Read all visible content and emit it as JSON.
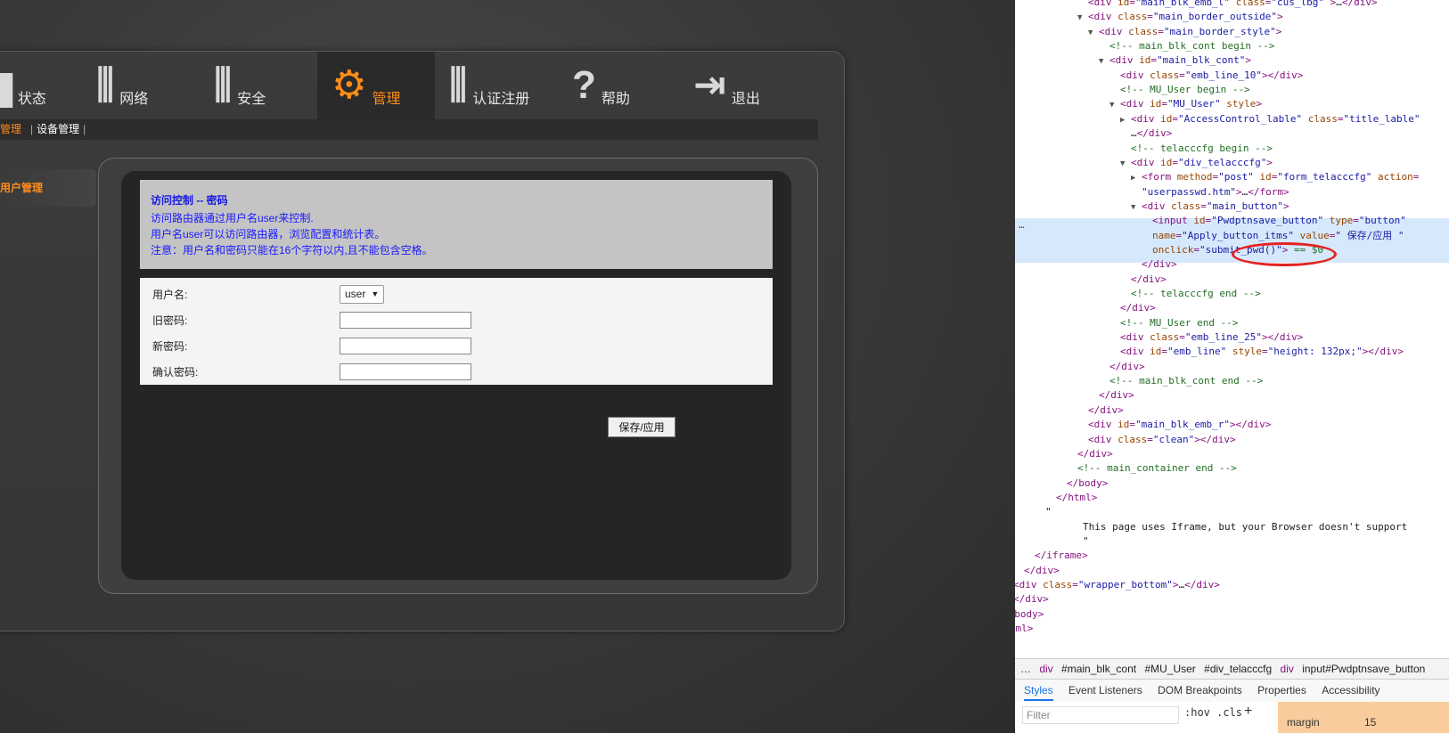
{
  "router": {
    "nav": [
      {
        "label": "状态",
        "icon": "status-icon",
        "glyph": "▆"
      },
      {
        "label": "网络",
        "icon": "network-sliders-icon",
        "glyph": "⫼"
      },
      {
        "label": "安全",
        "icon": "security-sliders-icon",
        "glyph": "⫼"
      },
      {
        "label": "管理",
        "icon": "gears-icon",
        "glyph": "⚙"
      },
      {
        "label": "认证注册",
        "icon": "register-sliders-icon",
        "glyph": "⫼"
      },
      {
        "label": "帮助",
        "icon": "question-icon",
        "glyph": "?"
      },
      {
        "label": "退出",
        "icon": "logout-icon",
        "glyph": "⇥"
      }
    ],
    "subnav": {
      "item1": "管理",
      "item2": "设备管理"
    },
    "leftmenu": {
      "item": "用户管理"
    },
    "info": {
      "title": "访问控制 -- 密码",
      "line1": "访问路由器通过用户名user来控制.",
      "line2": "用户名user可以访问路由器，浏览配置和统计表。",
      "line3": "注意：用户名和密码只能在16个字符以内,且不能包含空格。"
    },
    "form": {
      "username_label": "用户名:",
      "username_value": "user",
      "old_pwd_label": "旧密码:",
      "new_pwd_label": "新密码:",
      "confirm_pwd_label": "确认密码:"
    },
    "save_label": "保存/应用"
  },
  "devtools": {
    "lines": [
      {
        "indent": 0,
        "tri": "",
        "parts": [
          [
            "tag",
            "<div "
          ],
          [
            "att",
            "id"
          ],
          [
            "tag",
            "="
          ],
          [
            "val",
            "\"main_blk_emb_l\""
          ],
          [
            "att",
            " class"
          ],
          [
            "tag",
            "="
          ],
          [
            "val",
            "\"cus_lbg\""
          ],
          [
            "tag",
            " >"
          ],
          [
            "txtc",
            "…"
          ],
          [
            "tag",
            "</div>"
          ]
        ]
      },
      {
        "indent": 0,
        "tri": "▼",
        "parts": [
          [
            "tag",
            "<div "
          ],
          [
            "att",
            "class"
          ],
          [
            "tag",
            "="
          ],
          [
            "val",
            "\"main_border_outside\""
          ],
          [
            "tag",
            ">"
          ]
        ]
      },
      {
        "indent": 1,
        "tri": "▼",
        "parts": [
          [
            "tag",
            "<div "
          ],
          [
            "att",
            "class"
          ],
          [
            "tag",
            "="
          ],
          [
            "val",
            "\"main_border_style\""
          ],
          [
            "tag",
            ">"
          ]
        ]
      },
      {
        "indent": 2,
        "tri": "",
        "parts": [
          [
            "cmt",
            "<!-- main_blk_cont begin -->"
          ]
        ]
      },
      {
        "indent": 2,
        "tri": "▼",
        "parts": [
          [
            "tag",
            "<div "
          ],
          [
            "att",
            "id"
          ],
          [
            "tag",
            "="
          ],
          [
            "val",
            "\"main_blk_cont\""
          ],
          [
            "tag",
            ">"
          ]
        ]
      },
      {
        "indent": 3,
        "tri": "",
        "parts": [
          [
            "tag",
            "<div "
          ],
          [
            "att",
            "class"
          ],
          [
            "tag",
            "="
          ],
          [
            "val",
            "\"emb_line_10\""
          ],
          [
            "tag",
            "></div>"
          ]
        ]
      },
      {
        "indent": 3,
        "tri": "",
        "parts": [
          [
            "cmt",
            "<!-- MU_User begin -->"
          ]
        ]
      },
      {
        "indent": 3,
        "tri": "▼",
        "parts": [
          [
            "tag",
            "<div "
          ],
          [
            "att",
            "id"
          ],
          [
            "tag",
            "="
          ],
          [
            "val",
            "\"MU_User\""
          ],
          [
            "att",
            " style"
          ],
          [
            "tag",
            ">"
          ]
        ]
      },
      {
        "indent": 4,
        "tri": "▶",
        "parts": [
          [
            "tag",
            "<div "
          ],
          [
            "att",
            "id"
          ],
          [
            "tag",
            "="
          ],
          [
            "val",
            "\"AccessControl_lable\""
          ],
          [
            "att",
            " class"
          ],
          [
            "tag",
            "="
          ],
          [
            "val",
            "\"title_lable\""
          ]
        ]
      },
      {
        "indent": 4,
        "tri": "",
        "parts": [
          [
            "txtc",
            "…"
          ],
          [
            "tag",
            "</div>"
          ]
        ]
      },
      {
        "indent": 4,
        "tri": "",
        "parts": [
          [
            "cmt",
            "<!-- telacccfg begin -->"
          ]
        ]
      },
      {
        "indent": 4,
        "tri": "▼",
        "parts": [
          [
            "tag",
            "<div "
          ],
          [
            "att",
            "id"
          ],
          [
            "tag",
            "="
          ],
          [
            "val",
            "\"div_telacccfg\""
          ],
          [
            "tag",
            ">"
          ]
        ]
      },
      {
        "indent": 5,
        "tri": "▶",
        "parts": [
          [
            "tag",
            "<form "
          ],
          [
            "att",
            "method"
          ],
          [
            "tag",
            "="
          ],
          [
            "val",
            "\"post\""
          ],
          [
            "att",
            " id"
          ],
          [
            "tag",
            "="
          ],
          [
            "val",
            "\"form_telacccfg\""
          ],
          [
            "att",
            " action"
          ],
          [
            "tag",
            "="
          ]
        ]
      },
      {
        "indent": 5,
        "tri": "",
        "parts": [
          [
            "val",
            "\"userpasswd.htm\""
          ],
          [
            "tag",
            ">"
          ],
          [
            "txtc",
            "…"
          ],
          [
            "tag",
            "</form>"
          ]
        ]
      },
      {
        "indent": 5,
        "tri": "▼",
        "parts": [
          [
            "tag",
            "<div "
          ],
          [
            "att",
            "class"
          ],
          [
            "tag",
            "="
          ],
          [
            "val",
            "\"main_button\""
          ],
          [
            "tag",
            ">"
          ]
        ]
      },
      {
        "indent": 6,
        "tri": "",
        "parts": [
          [
            "tag",
            "<input "
          ],
          [
            "att",
            "id"
          ],
          [
            "tag",
            "="
          ],
          [
            "val",
            "\"Pwdptnsave_button\""
          ],
          [
            "att",
            " type"
          ],
          [
            "tag",
            "="
          ],
          [
            "val",
            "\"button\""
          ]
        ]
      },
      {
        "indent": 6,
        "tri": "",
        "parts": [
          [
            "att",
            "name"
          ],
          [
            "tag",
            "="
          ],
          [
            "val",
            "\"Apply_button_itms\""
          ],
          [
            "att",
            " value"
          ],
          [
            "tag",
            "="
          ],
          [
            "val",
            "\" 保存/应用 \""
          ]
        ]
      },
      {
        "indent": 6,
        "tri": "",
        "parts": [
          [
            "att",
            "onclick"
          ],
          [
            "tag",
            "="
          ],
          [
            "val",
            "\"submit_pwd()\""
          ],
          [
            "tag",
            "> "
          ],
          [
            "cmt",
            "== $0"
          ]
        ]
      },
      {
        "indent": 5,
        "tri": "",
        "parts": [
          [
            "tag",
            "</div>"
          ]
        ]
      },
      {
        "indent": 4,
        "tri": "",
        "parts": [
          [
            "tag",
            "</div>"
          ]
        ]
      },
      {
        "indent": 4,
        "tri": "",
        "parts": [
          [
            "cmt",
            "<!-- telacccfg end -->"
          ]
        ]
      },
      {
        "indent": 3,
        "tri": "",
        "parts": [
          [
            "tag",
            "</div>"
          ]
        ]
      },
      {
        "indent": 3,
        "tri": "",
        "parts": [
          [
            "cmt",
            "<!-- MU_User end -->"
          ]
        ]
      },
      {
        "indent": 3,
        "tri": "",
        "parts": [
          [
            "tag",
            "<div "
          ],
          [
            "att",
            "class"
          ],
          [
            "tag",
            "="
          ],
          [
            "val",
            "\"emb_line_25\""
          ],
          [
            "tag",
            "></div>"
          ]
        ]
      },
      {
        "indent": 3,
        "tri": "",
        "parts": [
          [
            "tag",
            "<div "
          ],
          [
            "att",
            "id"
          ],
          [
            "tag",
            "="
          ],
          [
            "val",
            "\"emb_line\""
          ],
          [
            "att",
            " style"
          ],
          [
            "tag",
            "="
          ],
          [
            "val",
            "\"height: 132px;\""
          ],
          [
            "tag",
            "></div>"
          ]
        ]
      },
      {
        "indent": 2,
        "tri": "",
        "parts": [
          [
            "tag",
            "</div>"
          ]
        ]
      },
      {
        "indent": 2,
        "tri": "",
        "parts": [
          [
            "cmt",
            "<!-- main_blk_cont end -->"
          ]
        ]
      },
      {
        "indent": 1,
        "tri": "",
        "parts": [
          [
            "tag",
            "</div>"
          ]
        ]
      },
      {
        "indent": 0,
        "tri": "",
        "parts": [
          [
            "tag",
            "</div>"
          ]
        ]
      },
      {
        "indent": 0,
        "tri": "",
        "parts": [
          [
            "tag",
            "<div "
          ],
          [
            "att",
            "id"
          ],
          [
            "tag",
            "="
          ],
          [
            "val",
            "\"main_blk_emb_r\""
          ],
          [
            "tag",
            "></div>"
          ]
        ]
      },
      {
        "indent": 0,
        "tri": "",
        "parts": [
          [
            "tag",
            "<div "
          ],
          [
            "att",
            "class"
          ],
          [
            "tag",
            "="
          ],
          [
            "val",
            "\"clean\""
          ],
          [
            "tag",
            "></div>"
          ]
        ]
      },
      {
        "indent": -1,
        "tri": "",
        "parts": [
          [
            "tag",
            "</div>"
          ]
        ]
      },
      {
        "indent": -1,
        "tri": "",
        "parts": [
          [
            "cmt",
            "<!-- main_container end -->"
          ]
        ]
      },
      {
        "indent": -2,
        "tri": "",
        "parts": [
          [
            "tag",
            "</body>"
          ]
        ]
      },
      {
        "indent": -3,
        "tri": "",
        "parts": [
          [
            "tag",
            "</html>"
          ]
        ]
      },
      {
        "indent": -4,
        "tri": "",
        "parts": [
          [
            "txtc",
            "\""
          ]
        ]
      },
      {
        "indent": -0.5,
        "tri": "",
        "parts": [
          [
            "txtc",
            "This page uses Iframe, but your Browser doesn't support"
          ]
        ]
      },
      {
        "indent": -0.5,
        "tri": "",
        "parts": [
          [
            "txtc",
            "\""
          ]
        ]
      },
      {
        "indent": -5,
        "tri": "",
        "parts": [
          [
            "tag",
            "</iframe>"
          ]
        ]
      },
      {
        "indent": -6,
        "tri": "",
        "parts": [
          [
            "tag",
            "</div>"
          ]
        ]
      },
      {
        "indent": -7,
        "tri": "▶",
        "parts": [
          [
            "tag",
            "<div "
          ],
          [
            "att",
            "class"
          ],
          [
            "tag",
            "="
          ],
          [
            "val",
            "\"wrapper_bottom\""
          ],
          [
            "tag",
            ">"
          ],
          [
            "txtc",
            "…"
          ],
          [
            "tag",
            "</div>"
          ]
        ]
      },
      {
        "indent": -7,
        "tri": "",
        "parts": [
          [
            "tag",
            "</div>"
          ]
        ]
      },
      {
        "indent": -8,
        "tri": "",
        "parts": [
          [
            "tag",
            "</body>"
          ]
        ]
      },
      {
        "indent": -9,
        "tri": "",
        "parts": [
          [
            "tag",
            "</html>"
          ]
        ]
      }
    ],
    "gutter_dots": "…",
    "breadcrumbs": [
      "…",
      "div",
      "#main_blk_cont",
      "#MU_User",
      "#div_telacccfg",
      "div",
      "input#Pwdptnsave_button"
    ],
    "tabs": [
      "Styles",
      "Event Listeners",
      "DOM Breakpoints",
      "Properties",
      "Accessibility"
    ],
    "filter_placeholder": "Filter",
    "hov_cls": ":hov  .cls",
    "plus": "+",
    "margin_label": "margin",
    "margin_value": "15"
  }
}
